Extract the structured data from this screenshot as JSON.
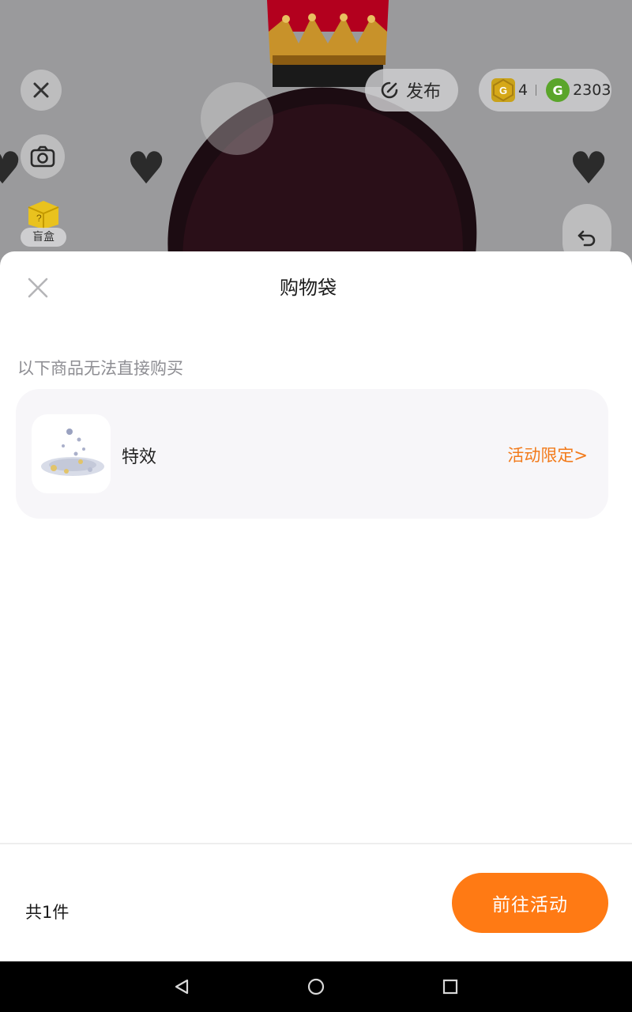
{
  "background": {
    "publish_label": "发布",
    "gold_coin_count": "4",
    "green_coin_count": "2303",
    "blind_box_label": "盲盒",
    "icons": [
      "close-icon",
      "camera-icon",
      "publish-icon",
      "undo-icon",
      "heart-icon"
    ]
  },
  "sheet": {
    "title": "购物袋",
    "notice": "以下商品无法直接购买",
    "items": [
      {
        "name": "特效",
        "link_label": "活动限定>"
      }
    ],
    "total_label": "共1件",
    "cta_label": "前往活动"
  },
  "colors": {
    "accent": "#ff7a14",
    "link": "#f27a1a",
    "card_bg": "#f7f6f9",
    "notice_text": "#8e8e93"
  },
  "navbar": {
    "icons": [
      "back-triangle-icon",
      "home-circle-icon",
      "recents-square-icon"
    ]
  }
}
